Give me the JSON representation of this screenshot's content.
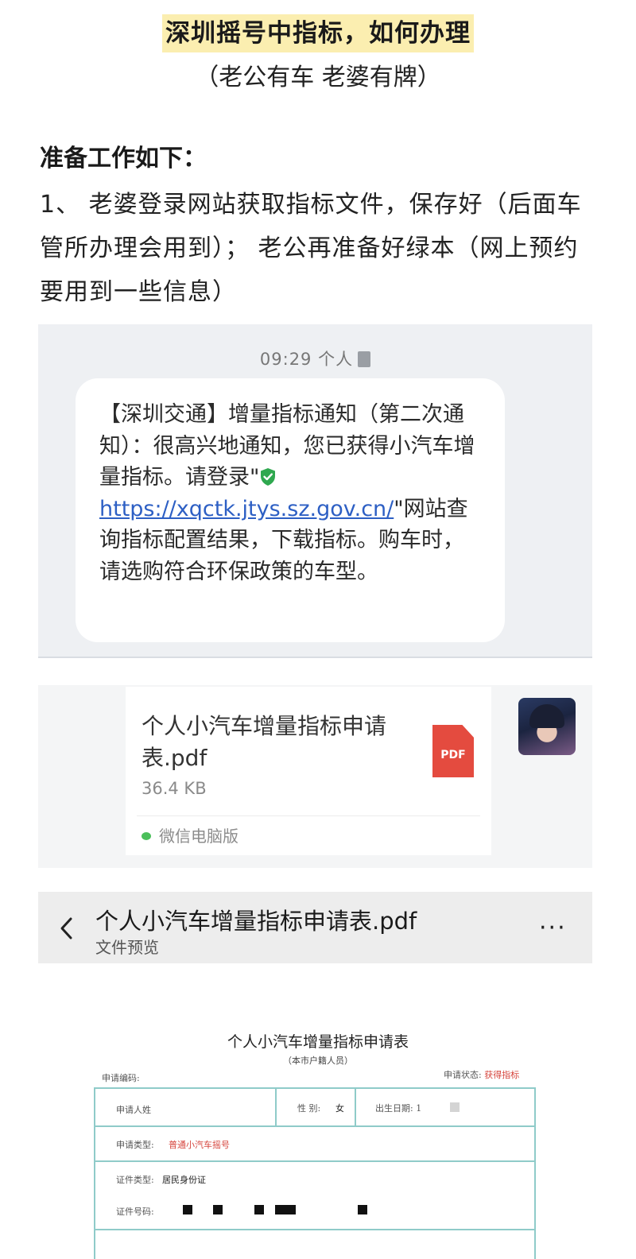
{
  "title": "深圳摇号中指标，如何办理",
  "subtitle": "（老公有车 老婆有牌）",
  "prep": {
    "heading": "准备工作如下：",
    "body": "1、 老婆登录网站获取指标文件，保存好（后面车管所办理会用到）； 老公再准备好绿本（网上预约要用到一些信息）"
  },
  "sms": {
    "time": "09:29 个人",
    "text_before_link": "【深圳交通】增量指标通知（第二次通知）：很高兴地通知，您已获得小汽车增量指标。请登录\"",
    "link": "https://xqctk.jtys.sz.gov.cn/",
    "text_after_link": "\"网站查询指标配置结果，下载指标。购车时，请选购符合环保政策的车型。",
    "shield_color": "#2fa84f",
    "link_color": "#2d5fc4"
  },
  "file_card": {
    "name": "个人小汽车增量指标申请表.pdf",
    "size": "36.4 KB",
    "icon_label": "PDF",
    "source": "微信电脑版",
    "icon_color": "#e44b3f"
  },
  "preview_bar": {
    "title": "个人小汽车增量指标申请表.pdf",
    "subtitle": "文件预览",
    "more": "···"
  },
  "form": {
    "title": "个人小汽车增量指标申请表",
    "note": "（本市户籍人员）",
    "code_label": "申请编码:",
    "status_label": "申请状态:",
    "status_value": "获得指标",
    "applicant_label": "申请人姓",
    "gender_label": "性 别:",
    "gender_value": "女",
    "birth_label": "出生日期: 1",
    "type_label": "申请类型:",
    "type_value": "普通小汽车摇号",
    "id_type_label": "证件类型:",
    "id_type_value": "居民身份证",
    "id_no_label": "证件号码:"
  }
}
